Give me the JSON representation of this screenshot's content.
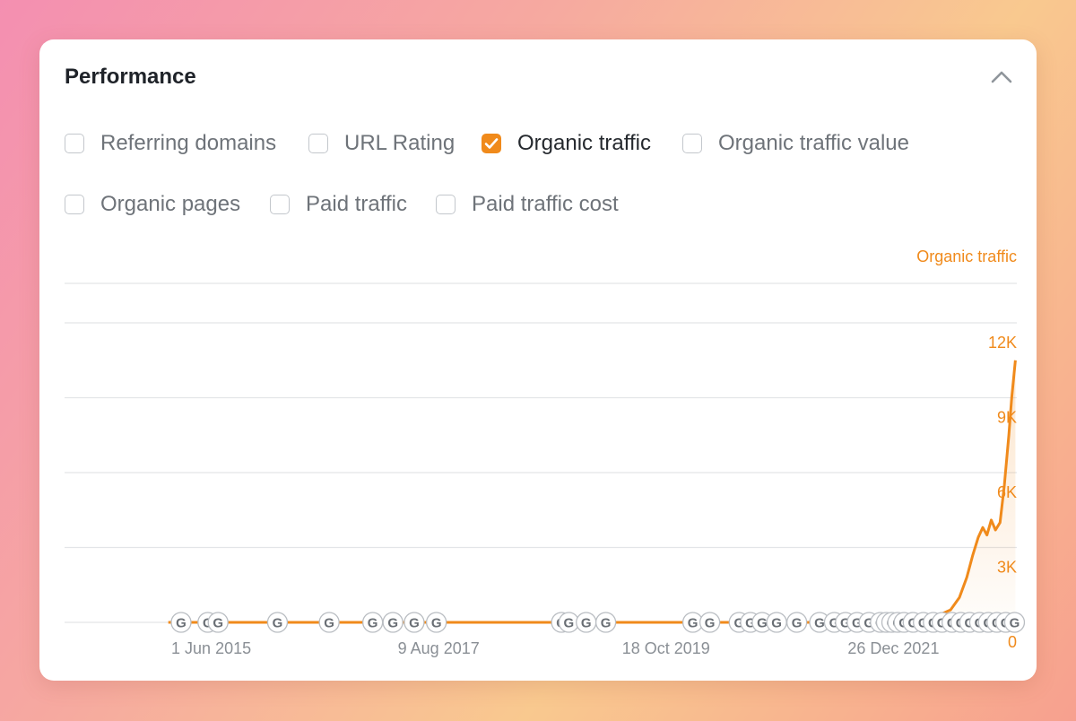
{
  "panel": {
    "title": "Performance",
    "collapse_icon": "chevron-up-icon"
  },
  "options": [
    {
      "label": "Referring domains",
      "checked": false
    },
    {
      "label": "URL Rating",
      "checked": false
    },
    {
      "label": "Organic traffic",
      "checked": true
    },
    {
      "label": "Organic traffic value",
      "checked": false
    },
    {
      "label": "Organic pages",
      "checked": false
    },
    {
      "label": "Paid traffic",
      "checked": false
    },
    {
      "label": "Paid traffic cost",
      "checked": false
    }
  ],
  "colors": {
    "accent": "#f08a1b",
    "grid": "#e3e5e8",
    "axis_text": "#8a8f95"
  },
  "chart_data": {
    "type": "area",
    "series": [
      {
        "name": "Organic traffic",
        "points": [
          [
            "2015-01-01",
            0
          ],
          [
            "2016-06-01",
            0
          ],
          [
            "2017-12-01",
            0
          ],
          [
            "2019-06-01",
            0
          ],
          [
            "2020-12-01",
            0
          ],
          [
            "2021-09-01",
            0
          ],
          [
            "2021-12-01",
            100
          ],
          [
            "2022-03-01",
            200
          ],
          [
            "2022-06-01",
            280
          ],
          [
            "2022-07-15",
            500
          ],
          [
            "2022-08-15",
            1000
          ],
          [
            "2022-09-10",
            1800
          ],
          [
            "2022-10-01",
            2700
          ],
          [
            "2022-10-20",
            3400
          ],
          [
            "2022-11-05",
            3800
          ],
          [
            "2022-11-20",
            3500
          ],
          [
            "2022-12-05",
            4100
          ],
          [
            "2022-12-20",
            3700
          ],
          [
            "2023-01-05",
            4000
          ],
          [
            "2023-01-20",
            5500
          ],
          [
            "2023-02-05",
            7500
          ],
          [
            "2023-02-15",
            9000
          ],
          [
            "2023-02-28",
            10500
          ]
        ]
      }
    ],
    "y_axis": {
      "label": "Organic traffic",
      "ticks": [
        "0",
        "3K",
        "6K",
        "9K",
        "12K"
      ],
      "range": [
        0,
        12000
      ]
    },
    "x_axis": {
      "ticks": [
        "1 Jun 2015",
        "9 Aug 2017",
        "18 Oct 2019",
        "26 Dec 2021"
      ],
      "tick_dates": [
        "2015-06-01",
        "2017-08-09",
        "2019-10-18",
        "2021-12-26"
      ],
      "range": [
        "2014-01-01",
        "2023-03-05"
      ]
    },
    "annotation_icon": "google-update-icon",
    "annotation_label": "G",
    "annotation_dates": [
      "2015-02-15",
      "2015-05-20",
      "2015-06-25",
      "2016-01-20",
      "2016-07-20",
      "2016-12-20",
      "2017-03-01",
      "2017-05-15",
      "2017-08-01",
      "2018-10-15",
      "2018-11-10",
      "2019-01-10",
      "2019-03-20",
      "2020-01-20",
      "2020-03-20",
      "2020-07-01",
      "2020-08-10",
      "2020-09-20",
      "2020-11-10",
      "2021-01-20",
      "2021-04-10",
      "2021-06-01",
      "2021-07-10",
      "2021-08-20",
      "2021-10-01",
      "2021-11-10",
      "2021-12-01",
      "2021-12-20",
      "2022-01-10",
      "2022-02-01",
      "2022-03-05",
      "2022-04-10",
      "2022-05-15",
      "2022-06-15",
      "2022-07-20",
      "2022-08-20",
      "2022-09-20",
      "2022-10-25",
      "2022-11-25",
      "2022-12-25",
      "2023-01-25",
      "2023-02-25"
    ],
    "grid": true,
    "legend": "none"
  }
}
